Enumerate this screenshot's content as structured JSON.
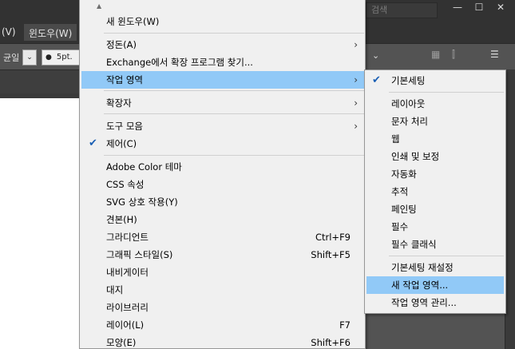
{
  "app": {
    "search_placeholder": "검색",
    "window_buttons": [
      "—",
      "☐",
      "✕"
    ],
    "menubar": {
      "items": [
        "(V)",
        "윈도우(W)"
      ]
    },
    "controlbar": {
      "uniform_label": "균일",
      "stroke_value": "5pt."
    }
  },
  "menu": {
    "scroll_indicator": "▲",
    "items": [
      {
        "label": "새 윈도우(W)"
      },
      {
        "label": "정돈(A)",
        "submenu": true
      },
      {
        "label": "Exchange에서 확장 프로그램 찾기..."
      },
      {
        "label": "작업 영역",
        "submenu": true,
        "highlighted": true
      },
      {
        "label": "확장자",
        "submenu": true
      },
      {
        "label": "도구 모음",
        "submenu": true
      },
      {
        "label": "제어(C)",
        "checked": true
      },
      {
        "label": "Adobe Color 테마"
      },
      {
        "label": "CSS 속성"
      },
      {
        "label": "SVG 상호 작용(Y)"
      },
      {
        "label": "견본(H)"
      },
      {
        "label": "그라디언트",
        "shortcut": "Ctrl+F9"
      },
      {
        "label": "그래픽 스타일(S)",
        "shortcut": "Shift+F5"
      },
      {
        "label": "내비게이터"
      },
      {
        "label": "대지"
      },
      {
        "label": "라이브러리"
      },
      {
        "label": "레이어(L)",
        "shortcut": "F7"
      },
      {
        "label": "모양(E)",
        "shortcut": "Shift+F6"
      }
    ]
  },
  "submenu": {
    "items": [
      {
        "label": "기본세팅",
        "checked": true
      },
      {
        "label": "레이아웃"
      },
      {
        "label": "문자 처리"
      },
      {
        "label": "웹"
      },
      {
        "label": "인쇄 및 보정"
      },
      {
        "label": "자동화"
      },
      {
        "label": "추적"
      },
      {
        "label": "페인팅"
      },
      {
        "label": "필수"
      },
      {
        "label": "필수 클래식"
      },
      {
        "label": "기본세팅 재설정"
      },
      {
        "label": "새 작업 영역...",
        "highlighted": true
      },
      {
        "label": "작업 영역 관리..."
      }
    ]
  },
  "colors": {
    "highlight": "#91c9f7",
    "menu_bg": "#f0f0f0",
    "app_dark": "#323232",
    "check": "#1a5fb4"
  }
}
